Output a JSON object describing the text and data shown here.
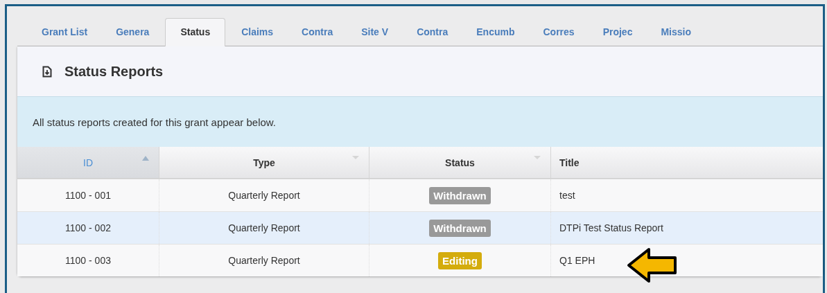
{
  "tabs": [
    {
      "label": "Grant List",
      "selected": false
    },
    {
      "label": "Genera",
      "selected": false
    },
    {
      "label": "Status",
      "selected": true
    },
    {
      "label": "Claims",
      "selected": false
    },
    {
      "label": "Contra",
      "selected": false
    },
    {
      "label": "Site V",
      "selected": false
    },
    {
      "label": "Contra",
      "selected": false
    },
    {
      "label": "Encumb",
      "selected": false
    },
    {
      "label": "Corres",
      "selected": false
    },
    {
      "label": "Projec",
      "selected": false
    },
    {
      "label": "Missio",
      "selected": false
    }
  ],
  "panel": {
    "title": "Status Reports",
    "info": "All status reports created for this grant appear below."
  },
  "table": {
    "columns": [
      {
        "label": "ID",
        "sorted": true
      },
      {
        "label": "Type",
        "sorted": false
      },
      {
        "label": "Status",
        "sorted": false
      },
      {
        "label": "Title"
      }
    ],
    "rows": [
      {
        "id": "1100 - 001",
        "type": "Quarterly Report",
        "status": "Withdrawn",
        "color": "#999999",
        "title": "test",
        "selected": false
      },
      {
        "id": "1100 - 002",
        "type": "Quarterly Report",
        "status": "Withdrawn",
        "color": "#999999",
        "title": "DTPi Test Status Report",
        "selected": true
      },
      {
        "id": "1100 - 003",
        "type": "Quarterly Report",
        "status": "Editing",
        "color": "#d4ac0d",
        "title": "Q1 EPH",
        "selected": false
      }
    ]
  }
}
